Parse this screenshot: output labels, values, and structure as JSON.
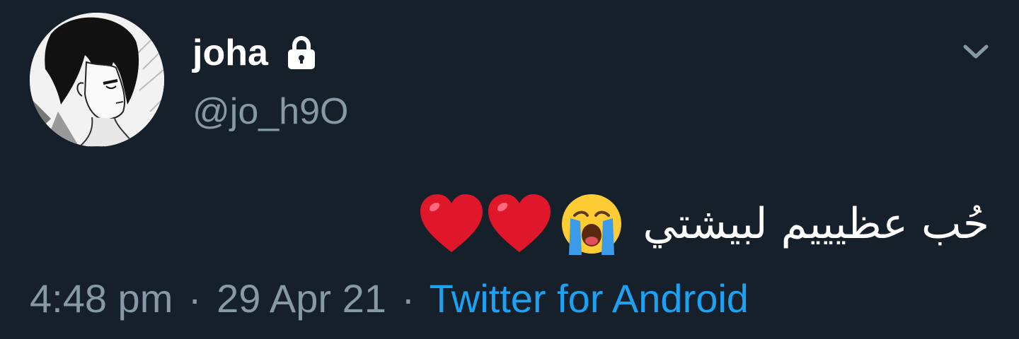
{
  "user": {
    "display_name": "joha",
    "handle": "@jo_h9O",
    "protected": true,
    "avatar_icon": "manga-avatar"
  },
  "tweet": {
    "text": "حُب عظيييم لبيشتي",
    "emojis": [
      "crying-face-icon",
      "red-heart-icon",
      "red-heart-icon"
    ]
  },
  "meta": {
    "time": "4:48 pm",
    "date": "29 Apr 21",
    "separator": "·",
    "source": "Twitter for Android"
  },
  "menu": {
    "icon": "chevron-down-icon"
  },
  "colors": {
    "background": "#15202b",
    "primary_text": "#ffffff",
    "secondary_text": "#8899a6",
    "link": "#1da1f2",
    "heart": "#e0162b",
    "emoji_yellow": "#ffcc33",
    "tear_blue": "#3b9be8"
  }
}
